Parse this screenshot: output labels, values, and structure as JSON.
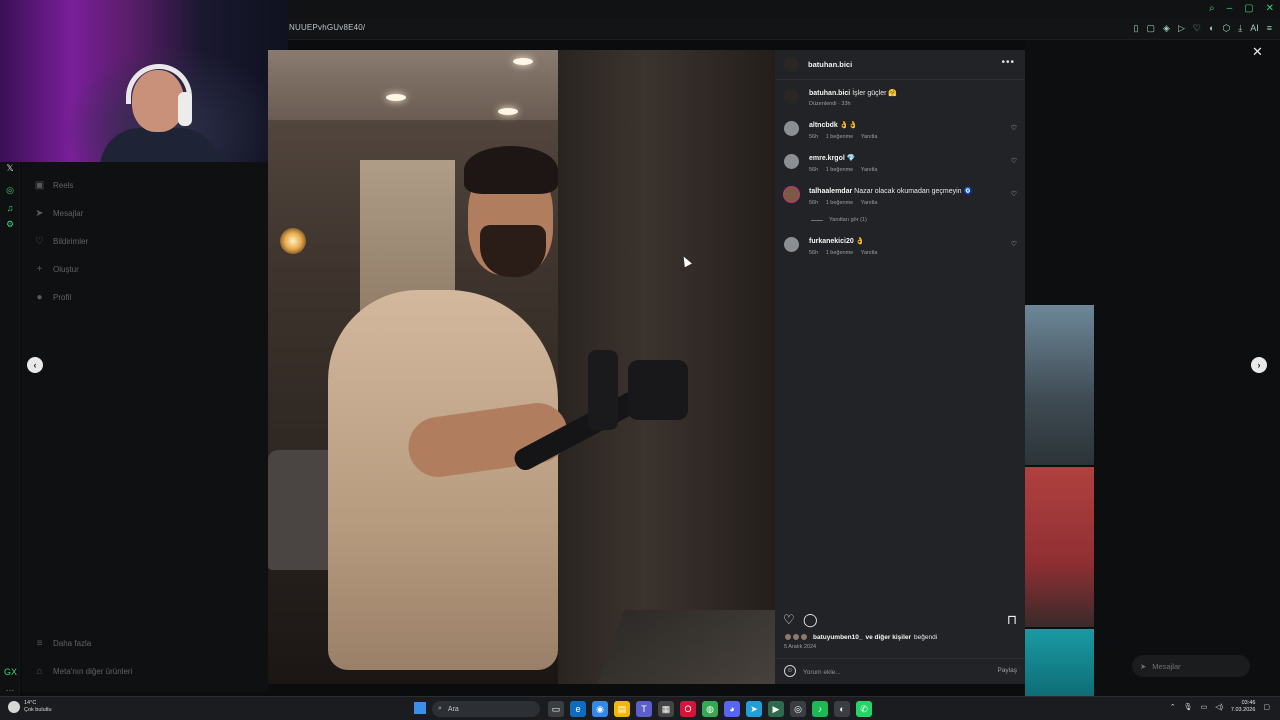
{
  "browser": {
    "url_fragment": "NUUEPvhGUv8E40/",
    "window_controls": [
      "search-icon",
      "minimize-icon",
      "maximize-icon",
      "close-icon"
    ]
  },
  "sidebar_nav": {
    "items": [
      {
        "label": "Reels",
        "icon": "reels-icon"
      },
      {
        "label": "Mesajlar",
        "icon": "messages-icon"
      },
      {
        "label": "Bildirimler",
        "icon": "heart-icon"
      },
      {
        "label": "Oluştur",
        "icon": "plus-icon"
      },
      {
        "label": "Profil",
        "icon": "profile-icon"
      }
    ],
    "bottom_items": [
      {
        "label": "Daha fazla",
        "icon": "menu-icon"
      },
      {
        "label": "Meta'nın diğer ürünleri",
        "icon": "meta-icon"
      }
    ]
  },
  "post": {
    "author": "batuhan.bici",
    "more_label": "•••",
    "caption": {
      "user": "batuhan.bici",
      "text": "İşler güçler 🤗",
      "meta": "Düzenlendi · 33h"
    },
    "comments": [
      {
        "user": "altncbdk",
        "text": "👌👌",
        "time": "56h",
        "likes": "1 beğenme",
        "reply": "Yanıtla"
      },
      {
        "user": "emre.krgol",
        "text": "💎",
        "time": "56h",
        "likes": "1 beğenme",
        "reply": "Yanıtla"
      },
      {
        "user": "talhaalemdar",
        "text": "Nazar olacak okumadan geçmeyin 🧿",
        "time": "56h",
        "likes": "1 beğenme",
        "reply": "Yanıtla",
        "view_replies": "Yanıtları gör (1)"
      },
      {
        "user": "furkanekici20",
        "text": "👌",
        "time": "56h",
        "likes": "1 beğenme",
        "reply": "Yanıtla"
      }
    ],
    "liked_by_user": "batuyumben10_",
    "liked_by_suffix": "ve diğer kişiler",
    "liked_by_verb": "beğendi",
    "date": "5 Aralık 2024",
    "comment_placeholder": "Yorum ekle...",
    "share_label": "Paylaş"
  },
  "messages_pill": {
    "label": "Mesajlar"
  },
  "taskbar": {
    "weather_temp": "14°C",
    "weather_desc": "Çok bulutlu",
    "search_label": "Ara",
    "time": "03:46",
    "date": "7.03.2026"
  }
}
